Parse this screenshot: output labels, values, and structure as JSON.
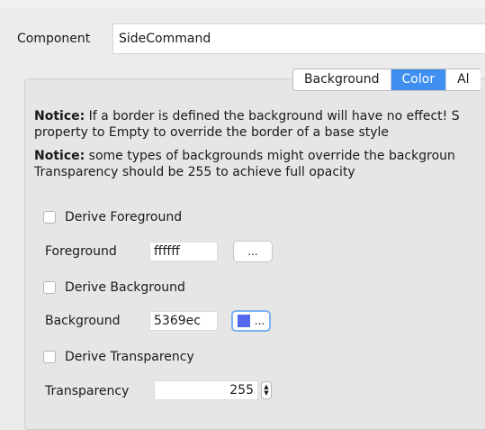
{
  "component": {
    "label": "Component",
    "value": "SideCommand"
  },
  "tabs": [
    {
      "label": "Background",
      "active": false
    },
    {
      "label": "Color",
      "active": true
    },
    {
      "label": "Al",
      "active": false
    }
  ],
  "notices": [
    {
      "bold": "Notice:",
      "line1": " If a border is defined the background will have no effect! S",
      "line2": "property to Empty to override the border of a base style"
    },
    {
      "bold": "Notice:",
      "line1": " some types of backgrounds might override the backgroun",
      "line2": "Transparency should be 255 to achieve full opacity"
    }
  ],
  "derive_foreground": {
    "label": "Derive Foreground",
    "checked": false
  },
  "foreground": {
    "label": "Foreground",
    "value": "ffffff",
    "button": "..."
  },
  "derive_background": {
    "label": "Derive Background",
    "checked": false
  },
  "background": {
    "label": "Background",
    "value": "5369ec",
    "button": "...",
    "swatch": "#5369ec"
  },
  "derive_transparency": {
    "label": "Derive Transparency",
    "checked": false
  },
  "transparency": {
    "label": "Transparency",
    "value": "255"
  },
  "colors": {
    "accent": "#3f8ff0",
    "swatch": "#5369ec"
  }
}
